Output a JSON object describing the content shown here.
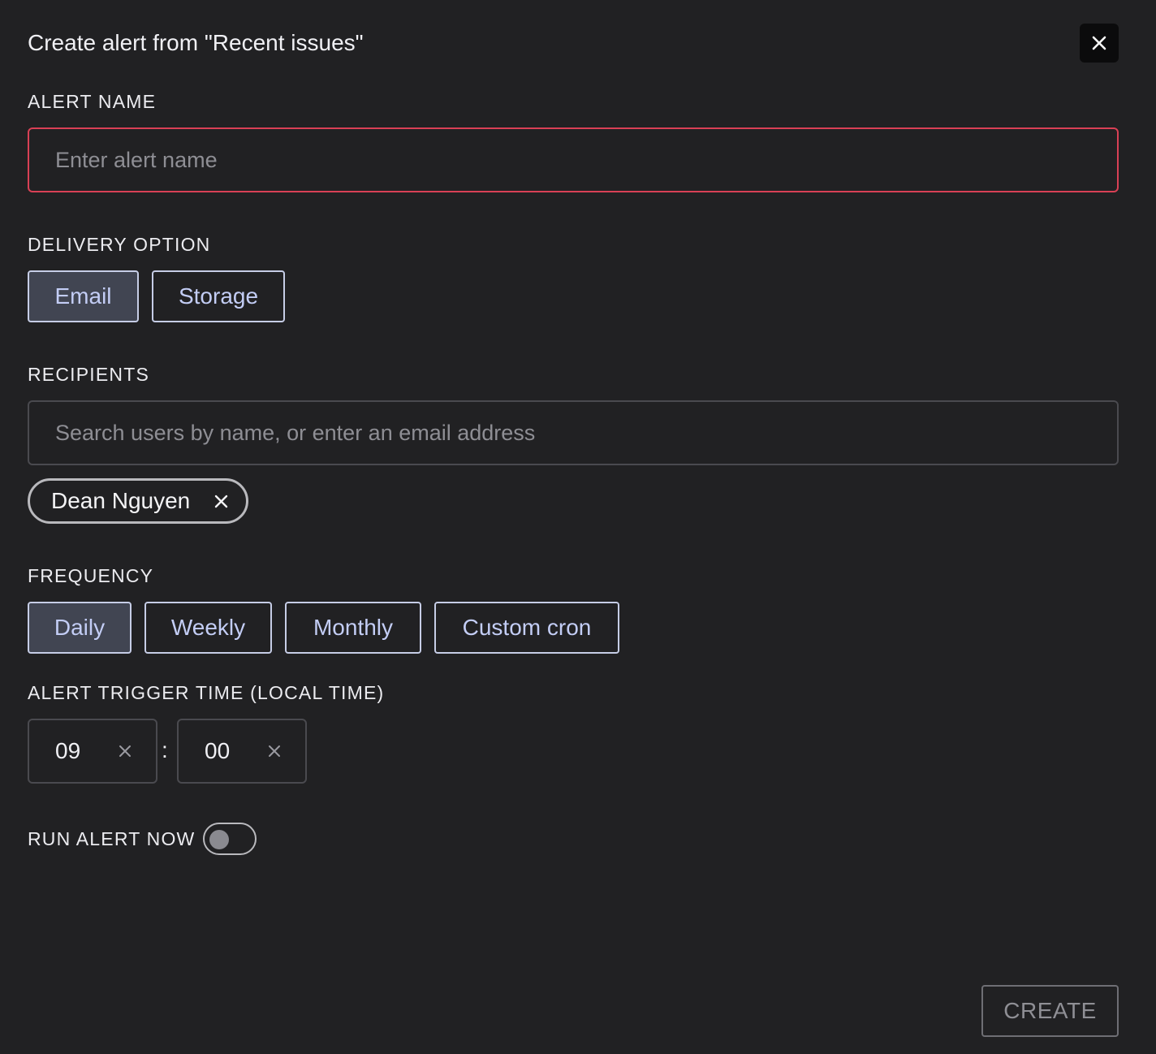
{
  "dialog": {
    "title": "Create alert from \"Recent issues\""
  },
  "alert_name": {
    "label": "ALERT NAME",
    "value": "",
    "placeholder": "Enter alert name"
  },
  "delivery": {
    "label": "DELIVERY OPTION",
    "options": [
      {
        "label": "Email",
        "selected": true
      },
      {
        "label": "Storage",
        "selected": false
      }
    ]
  },
  "recipients": {
    "label": "RECIPIENTS",
    "placeholder": "Search users by name, or enter an email address",
    "chips": [
      {
        "name": "Dean Nguyen"
      }
    ]
  },
  "frequency": {
    "label": "FREQUENCY",
    "options": [
      {
        "label": "Daily",
        "selected": true
      },
      {
        "label": "Weekly",
        "selected": false
      },
      {
        "label": "Monthly",
        "selected": false
      },
      {
        "label": "Custom cron",
        "selected": false
      }
    ]
  },
  "trigger_time": {
    "label": "ALERT TRIGGER TIME (LOCAL TIME)",
    "hour": "09",
    "separator": ":",
    "minute": "00"
  },
  "run_now": {
    "label": "RUN ALERT NOW",
    "enabled": false
  },
  "footer": {
    "create_label": "CREATE"
  },
  "colors": {
    "background": "#212123",
    "error_border": "#d94055",
    "pill_text": "#c3cdf5",
    "pill_active_bg": "#414552"
  },
  "icons": {
    "close": "close-icon",
    "chip_remove": "close-icon",
    "clear": "close-icon"
  }
}
